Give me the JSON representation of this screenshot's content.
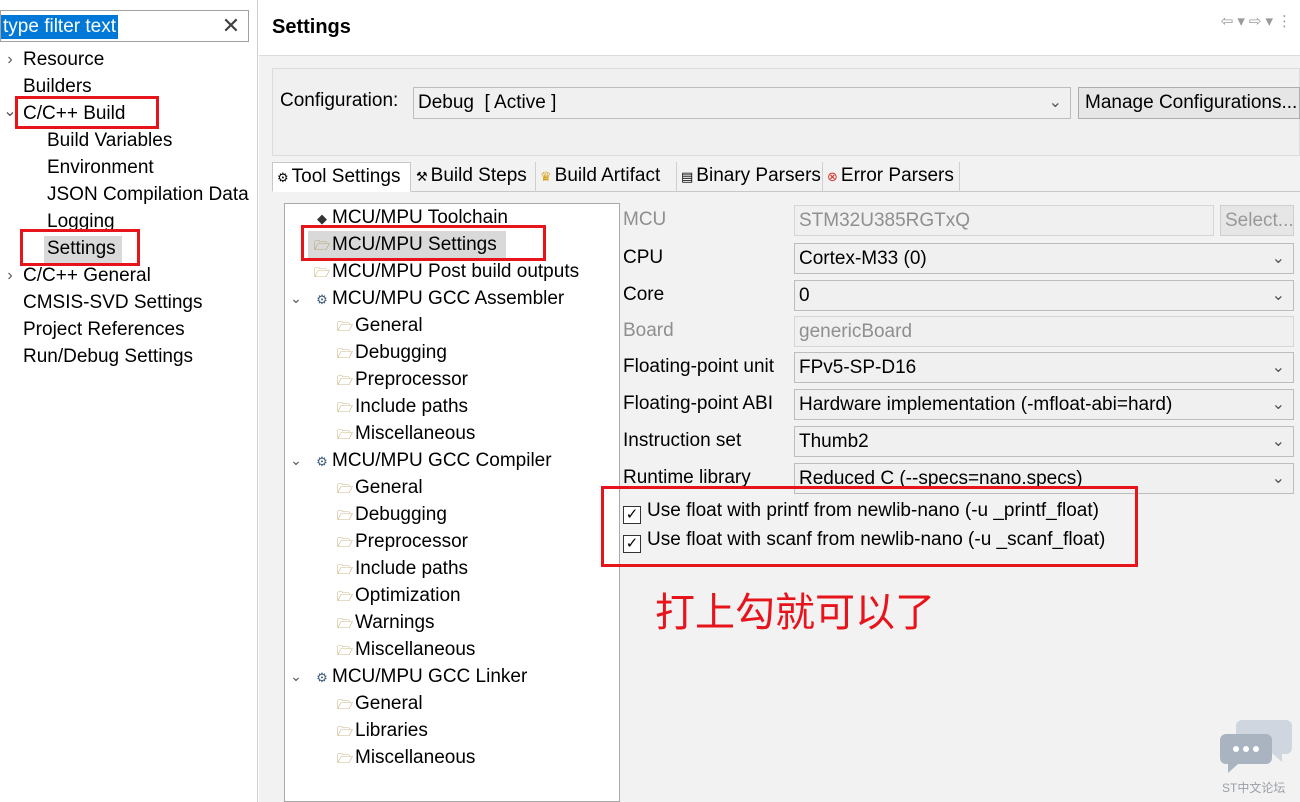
{
  "filter": {
    "value": "type filter text"
  },
  "nav": {
    "items": [
      {
        "label": "Resource",
        "chevron": "›"
      },
      {
        "label": "Builders"
      },
      {
        "label": "C/C++ Build",
        "chevron": "⌄"
      },
      {
        "label": "Build Variables"
      },
      {
        "label": "Environment"
      },
      {
        "label": "JSON Compilation Data"
      },
      {
        "label": "Logging"
      },
      {
        "label": "Settings"
      },
      {
        "label": "C/C++ General",
        "chevron": "›"
      },
      {
        "label": "CMSIS-SVD Settings"
      },
      {
        "label": "Project References"
      },
      {
        "label": "Run/Debug Settings"
      }
    ]
  },
  "page": {
    "title": "Settings"
  },
  "configuration": {
    "label": "Configuration:",
    "value": "Debug  [ Active ]",
    "manage_button": "Manage Configurations..."
  },
  "tabs": [
    {
      "label": "Tool Settings",
      "icon": "gear-icon",
      "glyph": "⚙"
    },
    {
      "label": "Build Steps",
      "icon": "hammer-icon",
      "glyph": "⚒"
    },
    {
      "label": "Build Artifact",
      "icon": "trophy-icon",
      "glyph": "🏆"
    },
    {
      "label": "Binary Parsers",
      "icon": "binary-icon",
      "glyph": "▤"
    },
    {
      "label": "Error Parsers",
      "icon": "error-icon",
      "glyph": "⊗"
    }
  ],
  "tool_tree": {
    "items": [
      {
        "label": "MCU/MPU Toolchain"
      },
      {
        "label": "MCU/MPU Settings"
      },
      {
        "label": "MCU/MPU Post build outputs"
      },
      {
        "label": "MCU/MPU GCC Assembler"
      },
      {
        "label": "General"
      },
      {
        "label": "Debugging"
      },
      {
        "label": "Preprocessor"
      },
      {
        "label": "Include paths"
      },
      {
        "label": "Miscellaneous"
      },
      {
        "label": "MCU/MPU GCC Compiler"
      },
      {
        "label": "General"
      },
      {
        "label": "Debugging"
      },
      {
        "label": "Preprocessor"
      },
      {
        "label": "Include paths"
      },
      {
        "label": "Optimization"
      },
      {
        "label": "Warnings"
      },
      {
        "label": "Miscellaneous"
      },
      {
        "label": "MCU/MPU GCC Linker"
      },
      {
        "label": "General"
      },
      {
        "label": "Libraries"
      },
      {
        "label": "Miscellaneous"
      }
    ]
  },
  "form": {
    "mcu": {
      "label": "MCU",
      "value": "STM32U385RGTxQ",
      "select_button": "Select..."
    },
    "cpu": {
      "label": "CPU",
      "value": "Cortex-M33 (0)"
    },
    "core": {
      "label": "Core",
      "value": "0"
    },
    "board": {
      "label": "Board",
      "value": "genericBoard"
    },
    "fpu": {
      "label": "Floating-point unit",
      "value": "FPv5-SP-D16"
    },
    "fabi": {
      "label": "Floating-point ABI",
      "value": "Hardware implementation (-mfloat-abi=hard)"
    },
    "iset": {
      "label": "Instruction set",
      "value": "Thumb2"
    },
    "runtime": {
      "label": "Runtime library",
      "value": "Reduced C (--specs=nano.specs)"
    },
    "printf_float": {
      "label": "Use float with printf from newlib-nano (-u _printf_float)",
      "checked": true,
      "mark": "✓"
    },
    "scanf_float": {
      "label": "Use float with scanf from newlib-nano (-u _scanf_float)",
      "checked": true,
      "mark": "✓"
    }
  },
  "annotation": {
    "text": "打上勾就可以了",
    "color": "#e8141b"
  },
  "watermark": {
    "text": "ST中文论坛"
  }
}
